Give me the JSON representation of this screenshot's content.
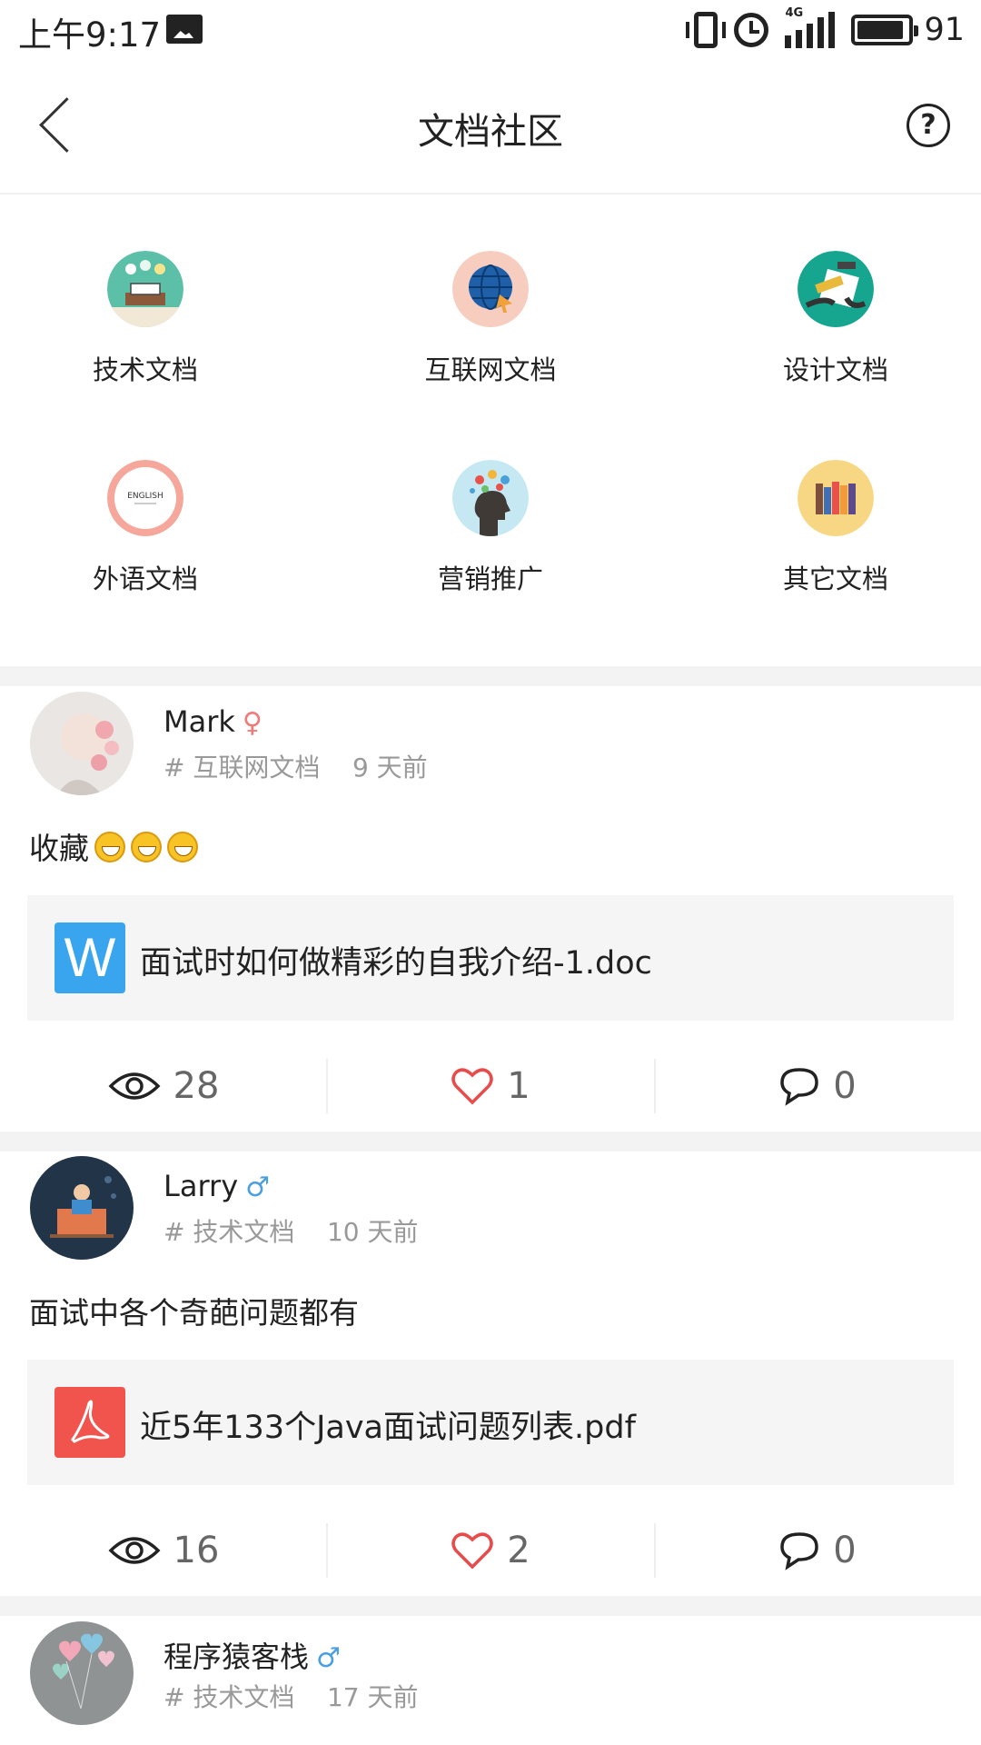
{
  "status_bar": {
    "time": "上午9:17",
    "network": "4G",
    "battery": "91"
  },
  "header": {
    "title": "文档社区"
  },
  "categories": [
    {
      "label": "技术文档",
      "icon": "tech-doc-icon"
    },
    {
      "label": "互联网文档",
      "icon": "internet-globe-icon"
    },
    {
      "label": "设计文档",
      "icon": "design-doc-icon"
    },
    {
      "label": "外语文档",
      "icon": "english-doc-icon",
      "icon_text": "ENGLISH"
    },
    {
      "label": "营销推广",
      "icon": "marketing-head-icon"
    },
    {
      "label": "其它文档",
      "icon": "books-icon"
    }
  ],
  "posts": [
    {
      "author": "Mark",
      "gender": "♀",
      "meta": "# 互联网文档    9 天前",
      "text": "收藏",
      "file": {
        "type": "W",
        "name": "面试时如何做精彩的自我介绍-1.doc"
      },
      "views": "28",
      "likes": "1",
      "comments": "0"
    },
    {
      "author": "Larry",
      "gender": "♂",
      "meta": "# 技术文档    10 天前",
      "text": "面试中各个奇葩问题都有",
      "file": {
        "type": "pdf",
        "name": "近5年133个Java面试问题列表.pdf"
      },
      "views": "16",
      "likes": "2",
      "comments": "0"
    },
    {
      "author": "程序猿客栈",
      "gender": "♂",
      "meta": "# 技术文档    17 天前"
    }
  ],
  "colors": {
    "like": "#e94b4b",
    "word_file": "#3aa5ef",
    "pdf_file": "#f0544c",
    "divider": "#f3f3f3"
  }
}
